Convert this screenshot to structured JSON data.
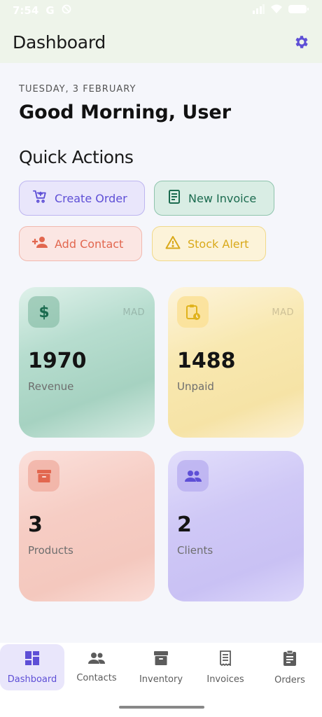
{
  "status_bar": {
    "time": "7:54",
    "carrier_icon": "google-g-icon",
    "dnd_icon": "do-not-disturb-icon"
  },
  "app_bar": {
    "title": "Dashboard",
    "settings_icon": "gear-icon",
    "accent": "#5e4fd6"
  },
  "header": {
    "date": "TUESDAY, 3 FEBRUARY",
    "greeting": "Good Morning, User"
  },
  "quick_actions": {
    "title": "Quick Actions",
    "create_order": "Create Order",
    "new_invoice": "New Invoice",
    "add_contact": "Add Contact",
    "stock_alert": "Stock Alert"
  },
  "stats": {
    "revenue": {
      "value": "1970",
      "label": "Revenue",
      "currency": "MAD",
      "icon": "dollar-icon",
      "color": "#1b6b4f"
    },
    "unpaid": {
      "value": "1488",
      "label": "Unpaid",
      "currency": "MAD",
      "icon": "clipboard-clock-icon",
      "color": "#e0b21c"
    },
    "products": {
      "value": "3",
      "label": "Products",
      "icon": "archive-box-icon",
      "color": "#e2674f"
    },
    "clients": {
      "value": "2",
      "label": "Clients",
      "icon": "people-icon",
      "color": "#5e4fd6"
    }
  },
  "bottom_nav": {
    "dashboard": "Dashboard",
    "contacts": "Contacts",
    "inventory": "Inventory",
    "invoices": "Invoices",
    "orders": "Orders",
    "active": "dashboard"
  }
}
